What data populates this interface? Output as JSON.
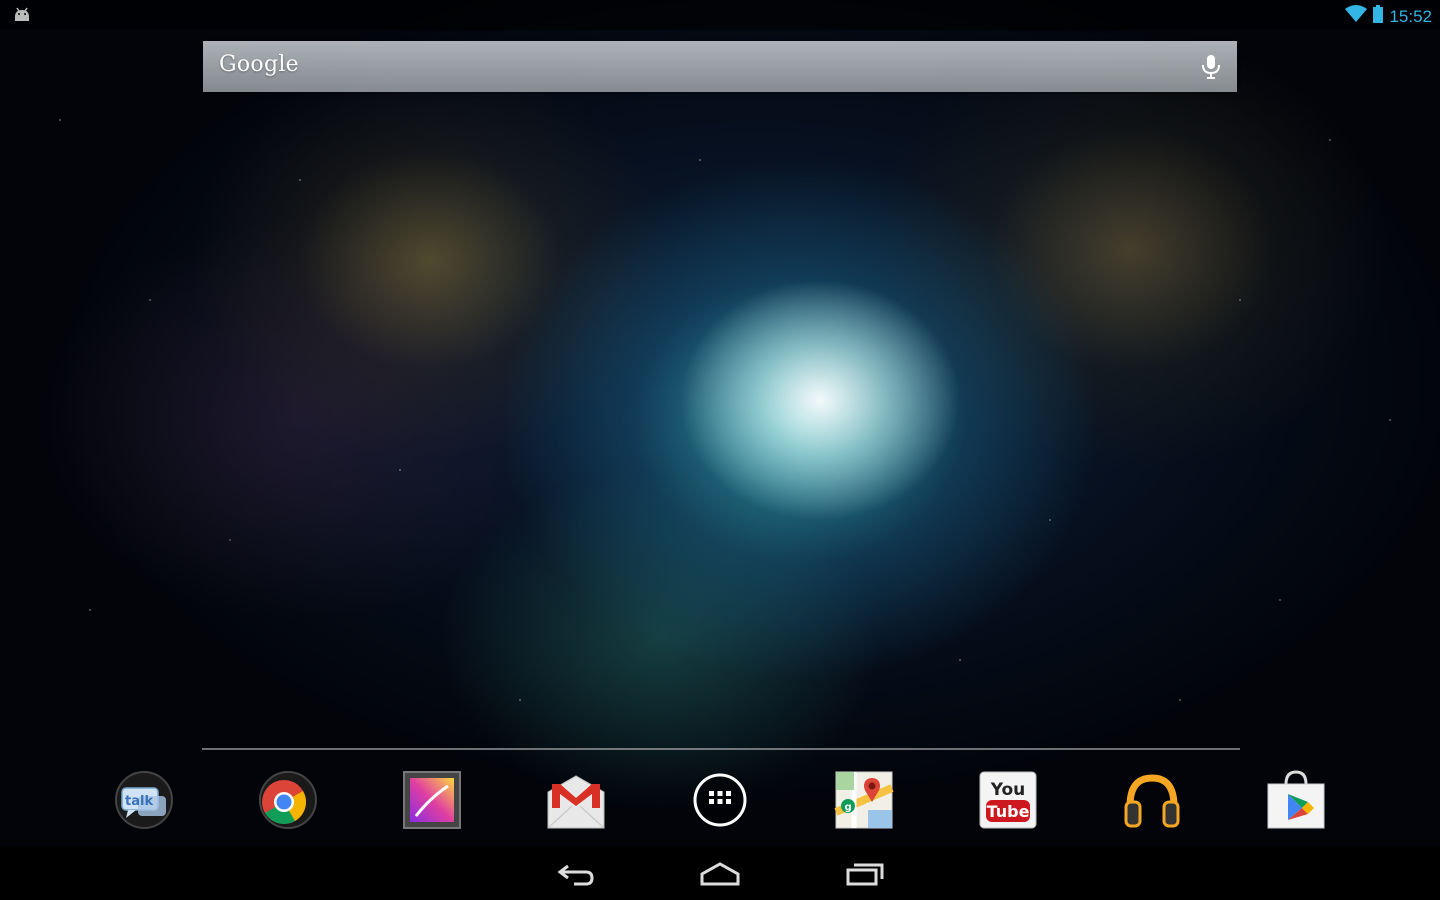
{
  "status_bar": {
    "time": "15:52",
    "left_icon": "android-debug-icon",
    "wifi_icon": "wifi-icon",
    "battery_icon": "battery-icon",
    "accent_color": "#33b5e5"
  },
  "search": {
    "logo_text": "Google",
    "mic_icon": "microphone-icon"
  },
  "dock": {
    "apps": [
      {
        "id": "talk",
        "icon": "talk-icon",
        "label_text": "talk"
      },
      {
        "id": "chrome",
        "icon": "chrome-icon"
      },
      {
        "id": "gallery",
        "icon": "gallery-icon"
      },
      {
        "id": "gmail",
        "icon": "gmail-icon"
      },
      {
        "id": "app-drawer",
        "icon": "app-drawer-icon"
      },
      {
        "id": "maps",
        "icon": "maps-icon"
      },
      {
        "id": "youtube",
        "icon": "youtube-icon",
        "label_top": "You",
        "label_bottom": "Tube"
      },
      {
        "id": "play-music",
        "icon": "headphones-icon"
      },
      {
        "id": "play-store",
        "icon": "play-store-icon"
      }
    ]
  },
  "nav": {
    "back_icon": "back-icon",
    "home_icon": "home-icon",
    "recents_icon": "recent-apps-icon"
  }
}
